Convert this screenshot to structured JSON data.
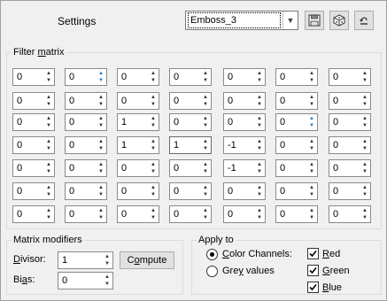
{
  "header": {
    "settings_label": "Settings",
    "preset_value": "Emboss_3",
    "icons": [
      "save-icon",
      "dice-random-icon",
      "reset-icon"
    ]
  },
  "filter_matrix": {
    "title_pre": "Filter ",
    "title_u": "m",
    "title_post": "atrix",
    "rows": [
      [
        "0",
        "0",
        "0",
        "0",
        "0",
        "0",
        "0"
      ],
      [
        "0",
        "0",
        "0",
        "0",
        "0",
        "0",
        "0"
      ],
      [
        "0",
        "0",
        "1",
        "0",
        "0",
        "0",
        "0"
      ],
      [
        "0",
        "0",
        "1",
        "1",
        "-1",
        "0",
        "0"
      ],
      [
        "0",
        "0",
        "0",
        "0",
        "-1",
        "0",
        "0"
      ],
      [
        "0",
        "0",
        "0",
        "0",
        "0",
        "0",
        "0"
      ],
      [
        "0",
        "0",
        "0",
        "0",
        "0",
        "0",
        "0"
      ]
    ]
  },
  "matrix_modifiers": {
    "title": "Matrix modifiers",
    "divisor_u": "D",
    "divisor_rest": "ivisor:",
    "divisor_value": "1",
    "bias_pre": "Bi",
    "bias_u": "a",
    "bias_post": "s:",
    "bias_value": "0",
    "compute_pre": "C",
    "compute_u": "o",
    "compute_post": "mpute"
  },
  "apply_to": {
    "title": "Apply to",
    "color_channels_u": "C",
    "color_channels_rest": "olor Channels:",
    "color_channels_selected": true,
    "grey_pre": "Gre",
    "grey_u": "y",
    "grey_post": " values",
    "grey_selected": false,
    "red_u": "R",
    "red_rest": "ed",
    "red_checked": true,
    "green_u": "G",
    "green_rest": "reen",
    "green_checked": true,
    "blue_u": "B",
    "blue_rest": "lue",
    "blue_checked": true
  }
}
